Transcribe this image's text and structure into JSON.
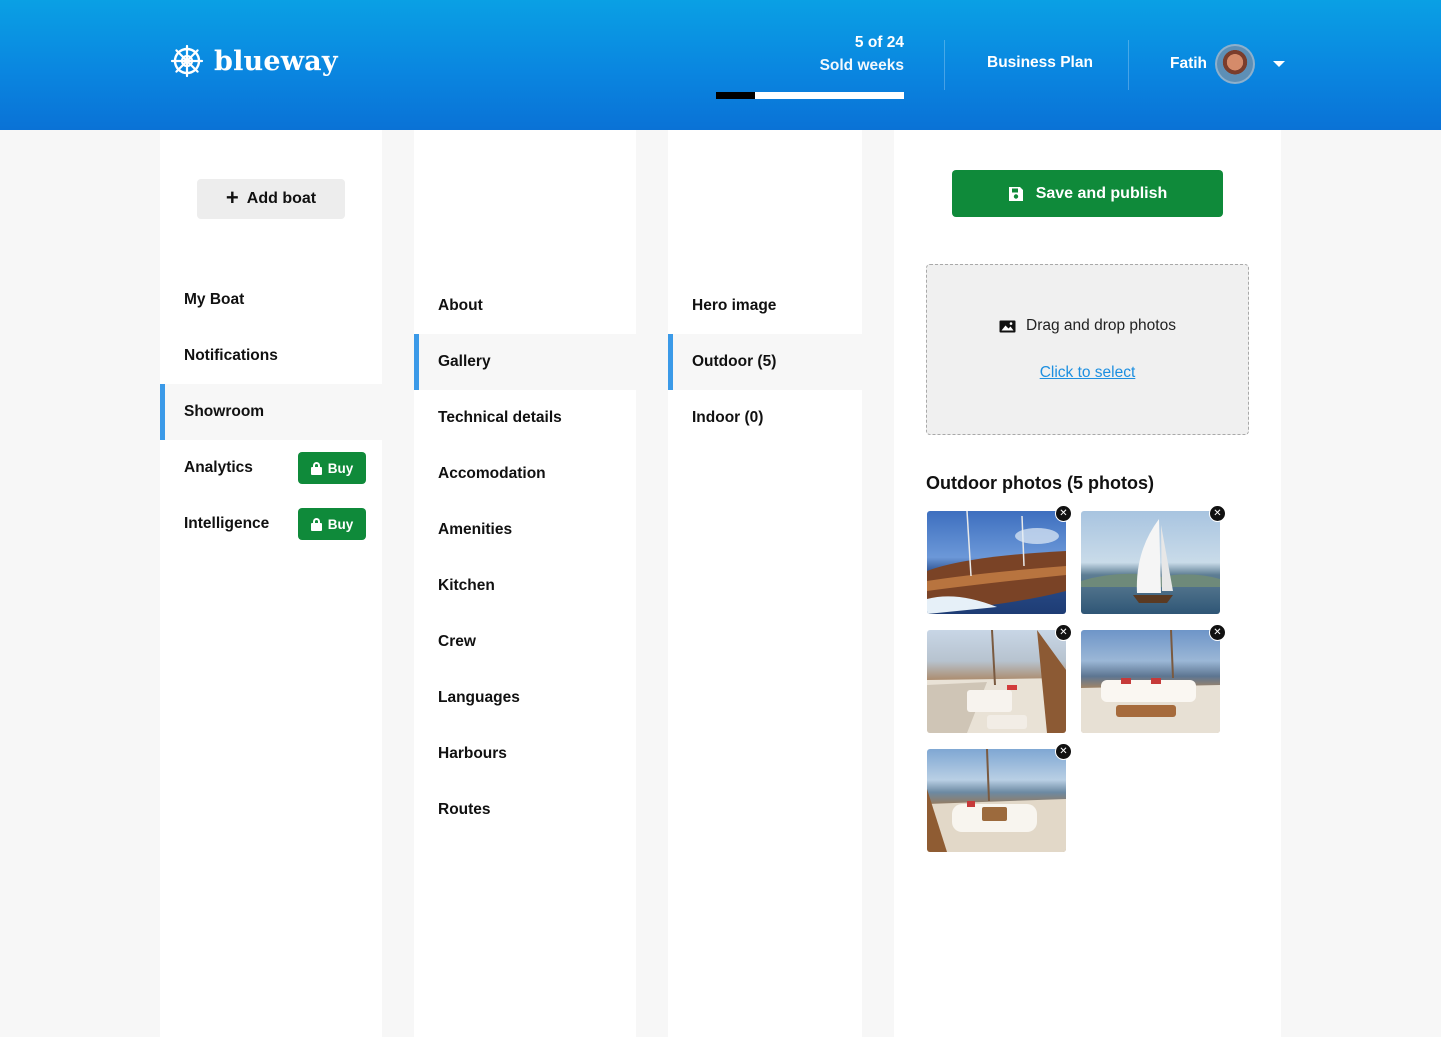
{
  "header": {
    "logo_text": "blueway",
    "sold_count": "5 of 24",
    "sold_label": "Sold weeks",
    "sold_progress": 0.2083,
    "business_plan_label": "Business Plan",
    "user_name": "Fatih"
  },
  "col1": {
    "add_boat_label": "Add boat",
    "items": [
      {
        "label": "My Boat"
      },
      {
        "label": "Notifications"
      },
      {
        "label": "Showroom",
        "active": true
      },
      {
        "label": "Analytics",
        "buy": "Buy"
      },
      {
        "label": "Intelligence",
        "buy": "Buy"
      }
    ]
  },
  "col2": {
    "items": [
      {
        "label": "About"
      },
      {
        "label": "Gallery",
        "active": true
      },
      {
        "label": "Technical details"
      },
      {
        "label": "Accomodation"
      },
      {
        "label": "Amenities"
      },
      {
        "label": "Kitchen"
      },
      {
        "label": "Crew"
      },
      {
        "label": "Languages"
      },
      {
        "label": "Harbours"
      },
      {
        "label": "Routes"
      }
    ]
  },
  "col3": {
    "items": [
      {
        "label": "Hero image"
      },
      {
        "label": "Outdoor (5)",
        "active": true
      },
      {
        "label": "Indoor (0)"
      }
    ]
  },
  "main": {
    "save_label": "Save and publish",
    "dropzone_text": "Drag and drop photos",
    "dropzone_link": "Click to select",
    "photos_title": "Outdoor photos (5 photos)",
    "photos": [
      {
        "icon": "sailing-yacht-photo"
      },
      {
        "icon": "sailboat-photo"
      },
      {
        "icon": "deck-photo"
      },
      {
        "icon": "deck-lounge-photo"
      },
      {
        "icon": "deck-sofa-photo"
      }
    ]
  },
  "colors": {
    "header_blue": "#0a86e0",
    "accent_blue": "#3b9ae8",
    "green": "#0f8a3a",
    "link_blue": "#1d8fe0"
  }
}
